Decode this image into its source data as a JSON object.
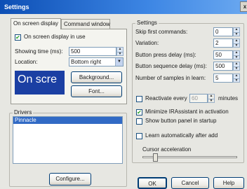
{
  "window": {
    "title": "Settings",
    "close_glyph": "x"
  },
  "tabs": [
    {
      "label": "On screen display"
    },
    {
      "label": "Command window"
    }
  ],
  "osd": {
    "in_use_label": "On screen display in use",
    "in_use_checked": true,
    "showing_time_label": "Showing time (ms):",
    "showing_time_value": "500",
    "location_label": "Location:",
    "location_value": "Bottom right",
    "preview_text": "On scre",
    "background_button": "Background...",
    "font_button": "Font..."
  },
  "drivers": {
    "group_label": "Drivers",
    "items": [
      "Pinnacle"
    ],
    "configure_button": "Configure..."
  },
  "settings": {
    "group_label": "Settings",
    "fields": [
      {
        "label": "Skip first commands:",
        "value": "0"
      },
      {
        "label": "Variation:",
        "value": "2"
      },
      {
        "label": "Button press delay (ms):",
        "value": "50"
      },
      {
        "label": "Button sequence delay (ms):",
        "value": "500"
      },
      {
        "label": "Number of samples in learn:",
        "value": "5"
      }
    ],
    "reactivate_label": "Reactivate every",
    "reactivate_value": "60",
    "reactivate_unit": "minutes",
    "reactivate_checked": false,
    "minimize_label": "Minimize IRAssistant in activation",
    "minimize_checked": true,
    "show_button_panel_label": "Show button panel in startup",
    "show_button_panel_checked": false,
    "learn_auto_label": "Learn automatically after add",
    "learn_auto_checked": false,
    "cursor_accel_label": "Cursor acceleration"
  },
  "dialog_buttons": {
    "ok": "OK",
    "cancel": "Cancel",
    "help": "Help"
  },
  "colors": {
    "title_bar": "#0d4fb5",
    "preview_bg": "#1b3fa3",
    "selection": "#316ac5",
    "check_mark": "#21a121"
  }
}
